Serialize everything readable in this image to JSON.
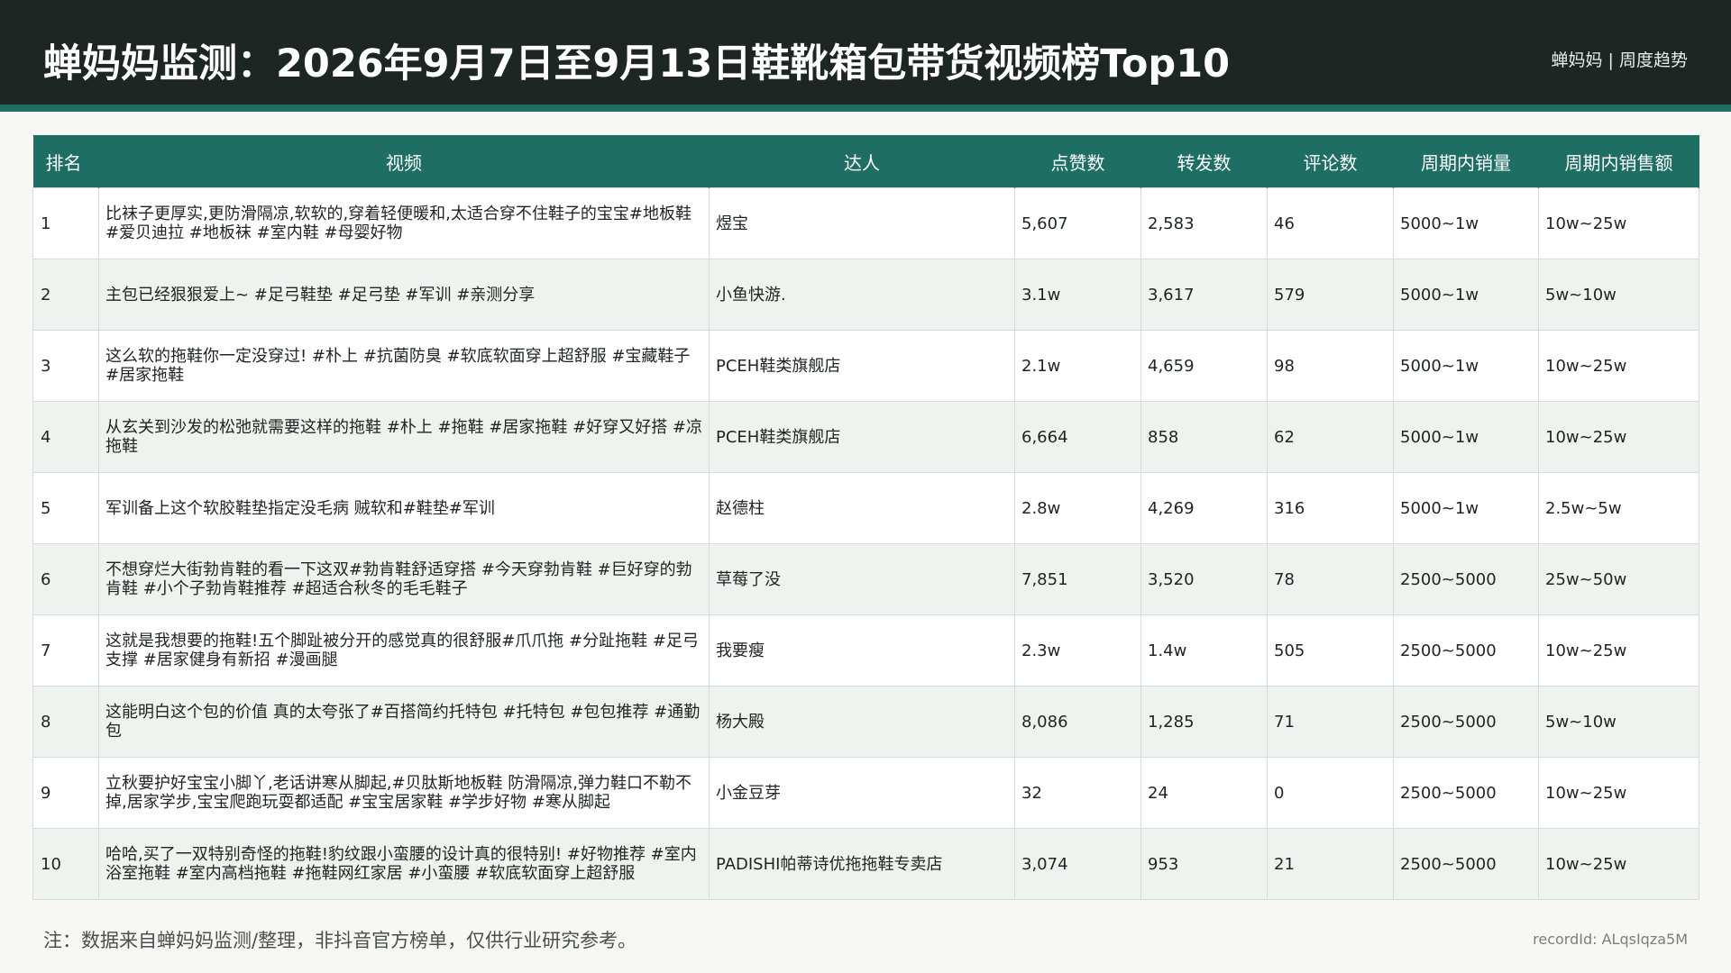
{
  "header": {
    "title": "蝉妈妈监测：2026年9月7日至9月13日鞋靴箱包带货视频榜Top10",
    "brand": "蝉妈妈 | 周度趋势"
  },
  "table": {
    "columns": [
      "排名",
      "视频",
      "达人",
      "点赞数",
      "转发数",
      "评论数",
      "周期内销量",
      "周期内销售额"
    ],
    "rows": [
      {
        "rank": "1",
        "video": "比袜子更厚实,更防滑隔凉,软软的,穿着轻便暖和,太适合穿不住鞋子的宝宝#地板鞋 #爱贝迪拉 #地板袜 #室内鞋 #母婴好物",
        "creator": "煜宝",
        "likes": "5,607",
        "shares": "2,583",
        "comments": "46",
        "sales": "5000~1w",
        "revenue": "10w~25w"
      },
      {
        "rank": "2",
        "video": "主包已经狠狠爱上~ #足弓鞋垫 #足弓垫 #军训 #亲测分享",
        "creator": "小鱼快游.",
        "likes": "3.1w",
        "shares": "3,617",
        "comments": "579",
        "sales": "5000~1w",
        "revenue": "5w~10w"
      },
      {
        "rank": "3",
        "video": "这么软的拖鞋你一定没穿过! #朴上 #抗菌防臭 #软底软面穿上超舒服 #宝藏鞋子 #居家拖鞋",
        "creator": "PCEH鞋类旗舰店",
        "likes": "2.1w",
        "shares": "4,659",
        "comments": "98",
        "sales": "5000~1w",
        "revenue": "10w~25w"
      },
      {
        "rank": "4",
        "video": "从玄关到沙发的松弛就需要这样的拖鞋 #朴上 #拖鞋 #居家拖鞋 #好穿又好搭 #凉拖鞋",
        "creator": "PCEH鞋类旗舰店",
        "likes": "6,664",
        "shares": "858",
        "comments": "62",
        "sales": "5000~1w",
        "revenue": "10w~25w"
      },
      {
        "rank": "5",
        "video": "军训备上这个软胶鞋垫指定没毛病 贼软和#鞋垫#军训",
        "creator": "赵德柱",
        "likes": "2.8w",
        "shares": "4,269",
        "comments": "316",
        "sales": "5000~1w",
        "revenue": "2.5w~5w"
      },
      {
        "rank": "6",
        "video": "不想穿烂大街勃肯鞋的看一下这双#勃肯鞋舒适穿搭 #今天穿勃肯鞋 #巨好穿的勃肯鞋 #小个子勃肯鞋推荐 #超适合秋冬的毛毛鞋子",
        "creator": "草莓了没",
        "likes": "7,851",
        "shares": "3,520",
        "comments": "78",
        "sales": "2500~5000",
        "revenue": "25w~50w"
      },
      {
        "rank": "7",
        "video": "这就是我想要的拖鞋!五个脚趾被分开的感觉真的很舒服#爪爪拖 #分趾拖鞋 #足弓支撑 #居家健身有新招 #漫画腿",
        "creator": "我要瘦",
        "likes": "2.3w",
        "shares": "1.4w",
        "comments": "505",
        "sales": "2500~5000",
        "revenue": "10w~25w"
      },
      {
        "rank": "8",
        "video": "这能明白这个包的价值 真的太夸张了#百搭简约托特包 #托特包 #包包推荐 #通勤包",
        "creator": "杨大殿",
        "likes": "8,086",
        "shares": "1,285",
        "comments": "71",
        "sales": "2500~5000",
        "revenue": "5w~10w"
      },
      {
        "rank": "9",
        "video": "立秋要护好宝宝小脚丫,老话讲寒从脚起,#贝肽斯地板鞋 防滑隔凉,弹力鞋口不勒不掉,居家学步,宝宝爬跑玩耍都适配 #宝宝居家鞋 #学步好物 #寒从脚起",
        "creator": "小金豆芽",
        "likes": "32",
        "shares": "24",
        "comments": "0",
        "sales": "2500~5000",
        "revenue": "10w~25w"
      },
      {
        "rank": "10",
        "video": "哈哈,买了一双特别奇怪的拖鞋!豹纹跟小蛮腰的设计真的很特别! #好物推荐 #室内浴室拖鞋 #室内高档拖鞋 #拖鞋网红家居 #小蛮腰 #软底软面穿上超舒服",
        "creator": "PADISHI帕蒂诗优拖拖鞋专卖店",
        "likes": "3,074",
        "shares": "953",
        "comments": "21",
        "sales": "2500~5000",
        "revenue": "10w~25w"
      }
    ]
  },
  "footer": {
    "note": "注：数据来自蝉妈妈监测/整理，非抖音官方榜单，仅供行业研究参考。",
    "record_id": "recordId: ALqsIqza5M"
  },
  "colors": {
    "header_bg": "#1e2624",
    "accent": "#1e6e63",
    "row_alt": "#eef3f0"
  }
}
